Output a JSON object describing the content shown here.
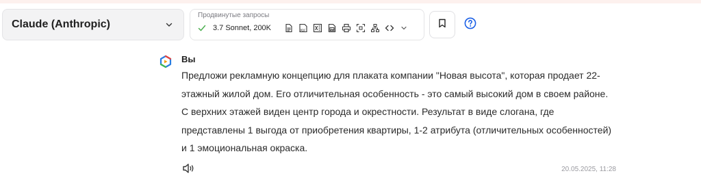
{
  "model_selector": {
    "label": "Claude (Anthropic)",
    "icon": "chevron-down-icon"
  },
  "advanced": {
    "title": "Продвинутые запросы",
    "model": "3.7 Sonnet, 200K",
    "tools": [
      "document-icon",
      "pdf-icon",
      "excel-icon",
      "image-doc-icon",
      "print-icon",
      "scan-icon",
      "hierarchy-icon",
      "code-icon",
      "chevron-down-icon"
    ]
  },
  "actions": {
    "bookmark_icon": "bookmark-icon",
    "help_icon": "help-icon"
  },
  "message": {
    "author": "Вы",
    "text": "Предложи рекламную концепцию для плаката компании \"Новая высота\", которая продает 22-этажный жилой дом. Его отличительная особенность - это самый высокий дом в своем районе. С верхних этажей виден центр города и окрестности. Результат в виде слогана, где представлены 1 выгода от приобретения квартиры, 1-2 атрибута (отличительных особенностей) и 1 эмоциональная окраска.",
    "timestamp": "20.05.2025, 11:28"
  },
  "colors": {
    "accent_blue": "#1a5fe6",
    "check_green": "#4caf50",
    "border": "#e4e4e6",
    "top_strip": "#fdf1ee"
  }
}
